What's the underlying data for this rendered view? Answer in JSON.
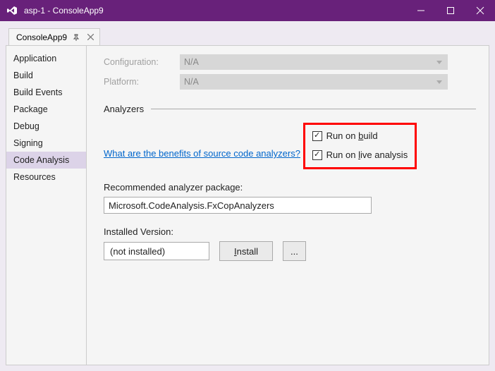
{
  "window": {
    "title": "asp-1 - ConsoleApp9"
  },
  "tab": {
    "label": "ConsoleApp9"
  },
  "sidebar": {
    "items": [
      {
        "label": "Application",
        "selected": false
      },
      {
        "label": "Build",
        "selected": false
      },
      {
        "label": "Build Events",
        "selected": false
      },
      {
        "label": "Package",
        "selected": false
      },
      {
        "label": "Debug",
        "selected": false
      },
      {
        "label": "Signing",
        "selected": false
      },
      {
        "label": "Code Analysis",
        "selected": true
      },
      {
        "label": "Resources",
        "selected": false
      }
    ]
  },
  "config": {
    "configuration_label": "Configuration:",
    "configuration_value": "N/A",
    "platform_label": "Platform:",
    "platform_value": "N/A"
  },
  "section": {
    "analyzers_header": "Analyzers",
    "benefits_link": "What are the benefits of source code analyzers?",
    "run_on_build_prefix": "Run on ",
    "run_on_build_ul": "b",
    "run_on_build_suffix": "uild",
    "run_on_live_prefix": "Run on ",
    "run_on_live_ul": "l",
    "run_on_live_suffix": "ive analysis",
    "recommended_label": "Recommended analyzer package:",
    "recommended_value": "Microsoft.CodeAnalysis.FxCopAnalyzers",
    "installed_label": "Installed Version:",
    "installed_value": "(not installed)",
    "install_btn_ul": "I",
    "install_btn_suffix": "nstall",
    "browse_btn": "..."
  }
}
